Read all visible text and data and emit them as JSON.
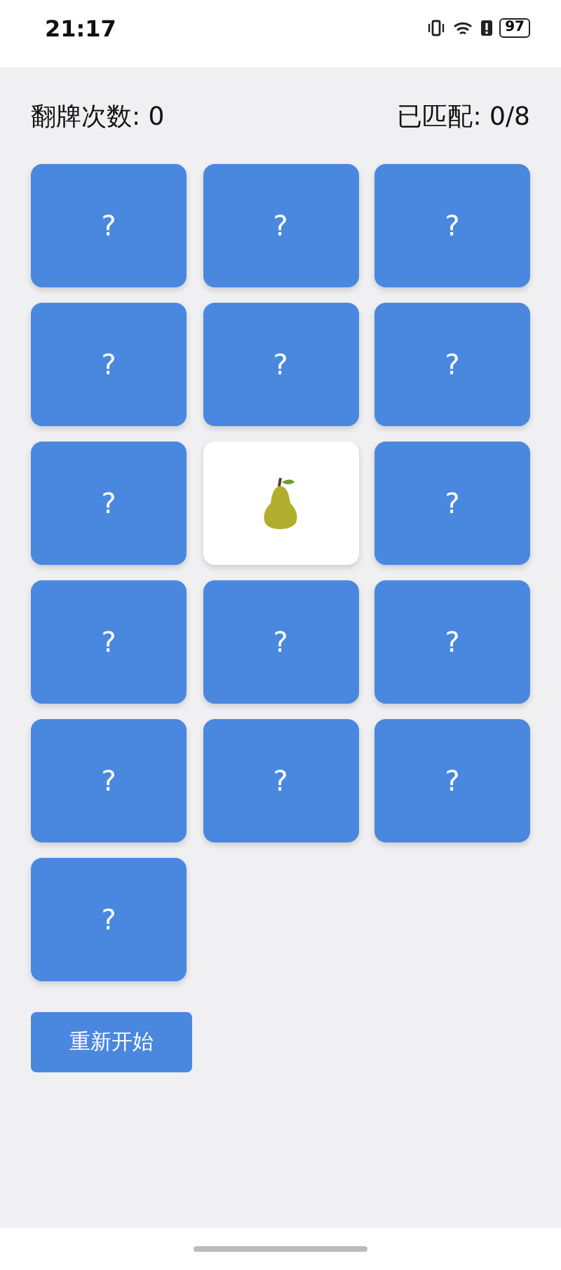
{
  "status_bar": {
    "time": "21:17",
    "battery": "97"
  },
  "header": {
    "flips": "翻牌次数: 0",
    "matched": "已匹配: 0/8"
  },
  "cards": [
    {
      "flipped": false,
      "label": "?"
    },
    {
      "flipped": false,
      "label": "?"
    },
    {
      "flipped": false,
      "label": "?"
    },
    {
      "flipped": false,
      "label": "?"
    },
    {
      "flipped": false,
      "label": "?"
    },
    {
      "flipped": false,
      "label": "?"
    },
    {
      "flipped": false,
      "label": "?"
    },
    {
      "flipped": true
    },
    {
      "flipped": false,
      "label": "?"
    },
    {
      "flipped": false,
      "label": "?"
    },
    {
      "flipped": false,
      "label": "?"
    },
    {
      "flipped": false,
      "label": "?"
    },
    {
      "flipped": false,
      "label": "?"
    },
    {
      "flipped": false,
      "label": "?"
    },
    {
      "flipped": false,
      "label": "?"
    },
    {
      "flipped": false,
      "label": "?"
    }
  ],
  "restart_button": "重新开始"
}
